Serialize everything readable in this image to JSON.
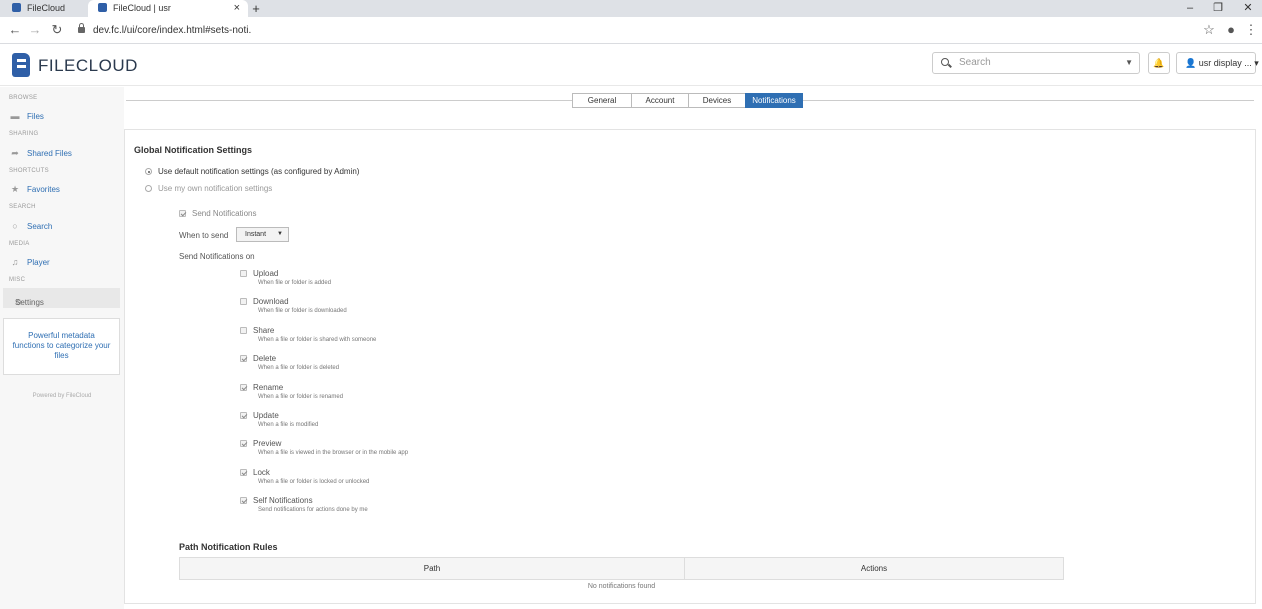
{
  "browser": {
    "tabs": [
      {
        "title": "FileCloud",
        "active": false
      },
      {
        "title": "FileCloud | usr",
        "active": true
      }
    ],
    "new_tab": "+",
    "close": "×",
    "url": "dev.fc.l/ui/core/index.html#sets-noti.",
    "window_controls": {
      "minimize": "–",
      "maximize": "❐",
      "close": "✕"
    }
  },
  "header": {
    "logo_text": "FILECLOUD",
    "search_placeholder": "Search",
    "user_label": "usr display ...",
    "brand_color": "#2f5fa7"
  },
  "sidebar": {
    "sections": [
      {
        "heading": "BROWSE",
        "item": "Files",
        "icon": "folder-icon"
      },
      {
        "heading": "SHARING",
        "item": "Shared Files",
        "icon": "share-icon"
      },
      {
        "heading": "SHORTCUTS",
        "item": "Favorites",
        "icon": "star-icon"
      },
      {
        "heading": "SEARCH",
        "item": "Search",
        "icon": "search-icon"
      },
      {
        "heading": "MEDIA",
        "item": "Player",
        "icon": "music-icon"
      },
      {
        "heading": "MISC",
        "item": "Settings",
        "icon": "gear-icon"
      }
    ],
    "promo": "Powerful metadata functions to categorize your files",
    "powered_by": "Powered by FileCloud"
  },
  "settings_tabs": [
    {
      "label": "General",
      "active": false
    },
    {
      "label": "Account",
      "active": false
    },
    {
      "label": "Devices",
      "active": false
    },
    {
      "label": "Notifications",
      "active": true
    }
  ],
  "notifications": {
    "title": "Global Notification Settings",
    "radio_default": "Use default notification settings (as configured by Admin)",
    "radio_own": "Use my own notification settings",
    "send_notifications": "Send Notifications",
    "when_to_send_label": "When to send",
    "when_to_send_value": "Instant",
    "send_on_label": "Send Notifications on",
    "options": [
      {
        "label": "Upload",
        "desc": "When file or folder is added",
        "checked": false
      },
      {
        "label": "Download",
        "desc": "When file or folder is downloaded",
        "checked": false
      },
      {
        "label": "Share",
        "desc": "When a file or folder is shared with someone",
        "checked": false
      },
      {
        "label": "Delete",
        "desc": "When a file or folder is deleted",
        "checked": true
      },
      {
        "label": "Rename",
        "desc": "When a file or folder is renamed",
        "checked": true
      },
      {
        "label": "Update",
        "desc": "When a file is modified",
        "checked": true
      },
      {
        "label": "Preview",
        "desc": "When a file is viewed in the browser or in the mobile app",
        "checked": true
      },
      {
        "label": "Lock",
        "desc": "When a file or folder is locked or unlocked",
        "checked": true
      },
      {
        "label": "Self Notifications",
        "desc": "Send notifications for actions done by me",
        "checked": true
      }
    ]
  },
  "path_rules": {
    "title": "Path Notification Rules",
    "columns": [
      "Path",
      "Actions"
    ],
    "empty": "No notifications found"
  }
}
